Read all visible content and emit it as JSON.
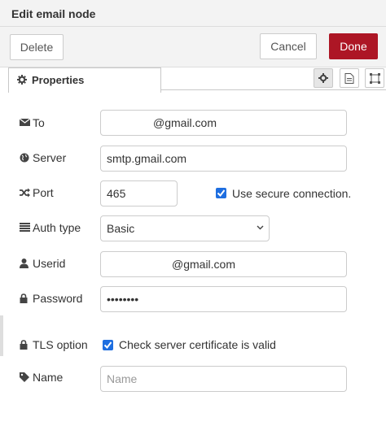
{
  "dialog": {
    "title": "Edit email node",
    "delete_label": "Delete",
    "cancel_label": "Cancel",
    "done_label": "Done",
    "tab_label": "Properties"
  },
  "fields": {
    "to": {
      "label": "To",
      "value": "@gmail.com",
      "icon": "envelope-icon"
    },
    "server": {
      "label": "Server",
      "value": "smtp.gmail.com",
      "icon": "globe-icon"
    },
    "port": {
      "label": "Port",
      "value": "465",
      "icon": "random-icon",
      "secure_label": "Use secure connection.",
      "secure_checked": true
    },
    "auth": {
      "label": "Auth type",
      "value": "Basic",
      "icon": "list-icon"
    },
    "userid": {
      "label": "Userid",
      "value": "@gmail.com",
      "icon": "user-icon"
    },
    "password": {
      "label": "Password",
      "value": "••••••••",
      "icon": "lock-icon"
    },
    "tls": {
      "label": "TLS option",
      "check_label": "Check server certificate is valid",
      "checked": true,
      "icon": "lock-icon"
    },
    "name": {
      "label": "Name",
      "placeholder": "Name",
      "icon": "tag-icon"
    }
  },
  "colors": {
    "done": "#ad1625",
    "checkbox": "#1e6ee0"
  }
}
